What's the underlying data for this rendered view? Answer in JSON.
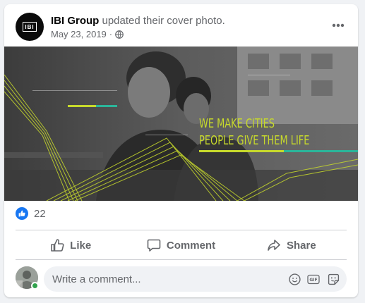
{
  "post": {
    "page_name": "IBI Group",
    "action_text": "updated their cover photo.",
    "date": "May 23, 2019",
    "separator": "·",
    "avatar_logo_text": "IBI"
  },
  "cover": {
    "line1": "WE MAKE CITIES",
    "line2": "PEOPLE GIVE THEM LIFE",
    "accent_color": "#c7d92c",
    "accent_bar_color": "#2bb59a"
  },
  "reactions": {
    "icon": "thumbs-up-icon",
    "count": "22"
  },
  "actions": {
    "like": "Like",
    "comment": "Comment",
    "share": "Share"
  },
  "composer": {
    "placeholder": "Write a comment...",
    "icons": [
      "emoji-icon",
      "gif-icon",
      "sticker-icon"
    ]
  },
  "colors": {
    "brand_blue": "#1877f2",
    "secondary_text": "#65676b",
    "online_green": "#31a24c"
  }
}
